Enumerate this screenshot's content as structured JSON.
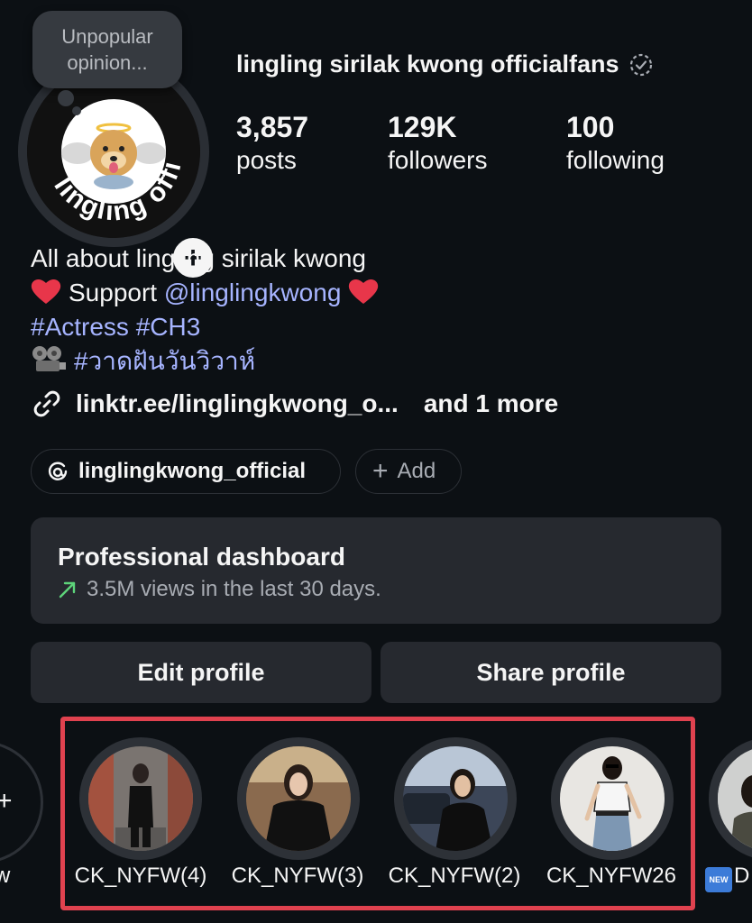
{
  "profile": {
    "username": "lingling sirilak kwong officialfans",
    "note": "Unpopular opinion...",
    "avatar_ring_text": "lingling offi",
    "stats": [
      {
        "value": "3,857",
        "label": "posts"
      },
      {
        "value": "129K",
        "label": "followers"
      },
      {
        "value": "100",
        "label": "following"
      }
    ]
  },
  "bio": {
    "line1": "All about lingling sirilak kwong",
    "support_prefix": "Support",
    "support_handle": "@linglingkwong",
    "hashtags": "#Actress #CH3",
    "thai_hashtag": "#วาดฝันวันวิวาห์",
    "link": "linktr.ee/linglingkwong_o...",
    "link_more": "and 1 more"
  },
  "chips": {
    "threads_label": "linglingkwong_official",
    "add_label": "Add"
  },
  "dashboard": {
    "title": "Professional dashboard",
    "subtitle": "3.5M views in the last 30 days."
  },
  "buttons": {
    "edit": "Edit profile",
    "share": "Share profile"
  },
  "highlights": [
    {
      "label": "CK_NYFW(4)"
    },
    {
      "label": "CK_NYFW(3)"
    },
    {
      "label": "CK_NYFW(2)"
    },
    {
      "label": "CK_NYFW26"
    }
  ],
  "partial_highlights": {
    "left_label": "w",
    "right_label": "D",
    "new_badge": "NEW"
  },
  "colors": {
    "background": "#0c1014",
    "link": "#a6b4ff",
    "card": "#26292f",
    "annotation_box": "#e0424f",
    "trend_arrow": "#5dd47a"
  }
}
